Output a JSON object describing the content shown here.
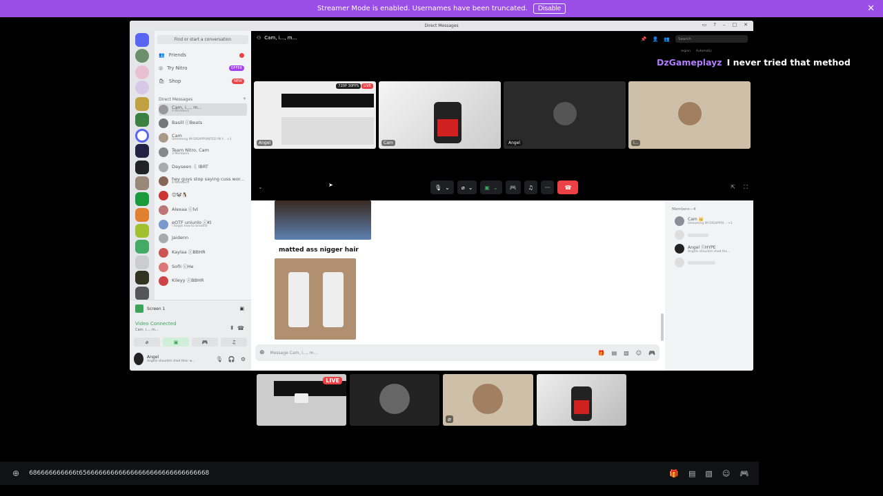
{
  "banner": {
    "text": "Streamer Mode is enabled. Usernames have been truncated.",
    "button": "Disable",
    "close": "✕"
  },
  "window": {
    "title": "Direct Messages",
    "search_placeholder": "Find or start a conversation",
    "nav": [
      {
        "label": "Friends",
        "badge": ""
      },
      {
        "label": "Try Nitro",
        "badge": "OFFER"
      },
      {
        "label": "Shop",
        "badge": "NEW"
      }
    ],
    "direct_messages_label": "Direct Messages",
    "dms": [
      {
        "name": "Cam, i..., m...",
        "sub": "4 Members"
      },
      {
        "name": "Basill ⓒBeats",
        "sub": ""
      },
      {
        "name": "Cam",
        "sub": "Streaming IM DISAPPOINTED IN Y...  +1"
      },
      {
        "name": "Team Nitro, Cam",
        "sub": "3 Members"
      },
      {
        "name": "Dayseen 🐇IBRT",
        "sub": ""
      },
      {
        "name": "hey guys stop saying cuss wor...",
        "sub": "4 Members"
      },
      {
        "name": "😊🐼🐧",
        "sub": ""
      },
      {
        "name": "Alexaa ⓒlvl",
        "sub": ""
      },
      {
        "name": "eOTF uniunlo ⓒKI",
        "sub": "i forgot how to breathe"
      },
      {
        "name": "Jaidenn",
        "sub": ""
      },
      {
        "name": "Kaylaa ⓒBBHR",
        "sub": ""
      },
      {
        "name": "Sofii ⓒHe",
        "sub": ""
      },
      {
        "name": "Kileyy ⓒBBHR",
        "sub": ""
      }
    ],
    "screen_label": "Screen 1",
    "video_connected": "Video Connected",
    "video_sub": "Cam, i..., m...",
    "user_name": "Angel",
    "user_sub": "Angels shouldnt shed their w...",
    "call_header": "Cam, i..., m...",
    "call_search": "Search",
    "region_label": "region",
    "region_value": "Automatic",
    "tiles": [
      {
        "label": "Angel",
        "badge": "720P 30FPS",
        "live": "LIVE"
      },
      {
        "label": "Cam"
      },
      {
        "label": "Angel"
      },
      {
        "label": "i..."
      }
    ],
    "message_text": "matted ass nigger hair",
    "composer_placeholder": "Message Cam, i..., m...",
    "members_header": "Members—4",
    "members": [
      {
        "name": "Cam 👑",
        "sub": "Streaming IM DISAPPOI...  +1"
      },
      {
        "name": "",
        "sub": ""
      },
      {
        "name": "Angel ⓒHYPE",
        "sub": "Angels shouldnt shed the..."
      },
      {
        "name": "",
        "sub": ""
      }
    ]
  },
  "overlay": {
    "user": "DzGameplayz",
    "message": "I never tried that method"
  },
  "bottom_tiles": {
    "live": "LIVE"
  },
  "bottom_input": {
    "value": "686666666666t656666666666666666666666666666668"
  }
}
